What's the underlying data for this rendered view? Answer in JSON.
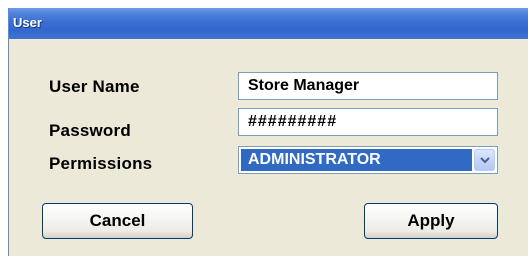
{
  "window": {
    "title": "User"
  },
  "form": {
    "user_name_label": "User Name",
    "user_name_value": "Store Manager",
    "password_label": "Password",
    "password_value": "#########",
    "permissions_label": "Permissions",
    "permissions_selected": "ADMINISTRATOR"
  },
  "buttons": {
    "cancel_label": "Cancel",
    "apply_label": "Apply"
  },
  "icons": {
    "dropdown": "chevron-down-icon"
  },
  "colors": {
    "titlebar": "#3a6fd3",
    "selection": "#316ac5",
    "dialog_background": "#ece9d8"
  }
}
